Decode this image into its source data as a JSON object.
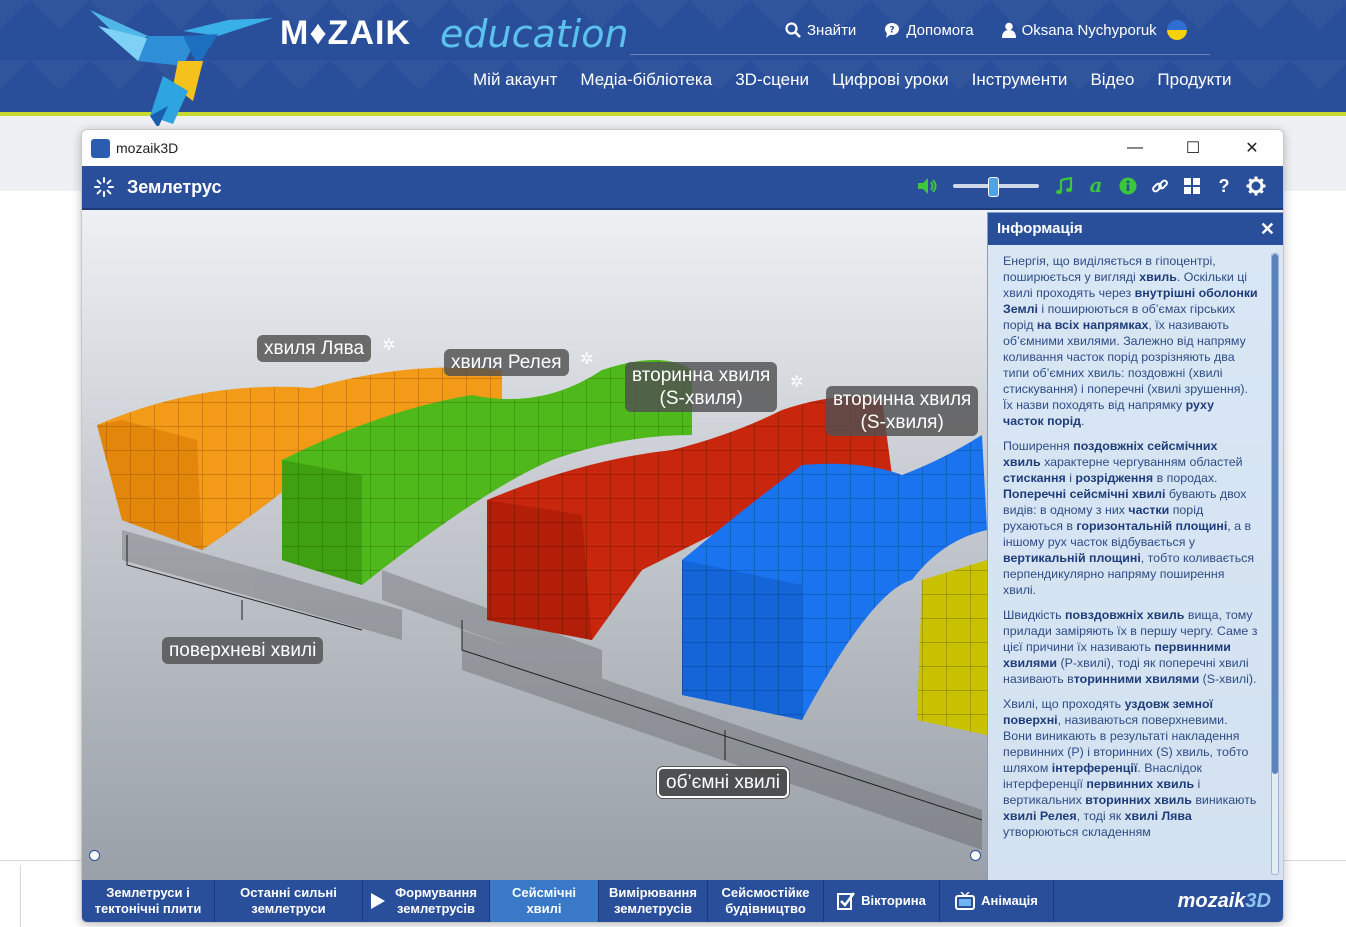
{
  "site": {
    "logo_text": "M♦ZAIK",
    "logo_sub": "education",
    "top_links": [
      {
        "icon": "search-icon",
        "label": "Знайти"
      },
      {
        "icon": "help-chat-icon",
        "label": "Допомога"
      },
      {
        "icon": "user-icon",
        "label": "Oksana Nychyporuk"
      }
    ],
    "nav": [
      "Мій акаунт",
      "Медіа-бібліотека",
      "3D-сцени",
      "Цифрові уроки",
      "Інструменти",
      "Відео",
      "Продукти"
    ]
  },
  "window": {
    "title": "mozaik3D",
    "controls": {
      "minimize": "—",
      "maximize": "☐",
      "close": "✕"
    }
  },
  "toolbar": {
    "scene_title": "Землетрус",
    "volume_level": 0.45,
    "icons": [
      "speaker-icon",
      "music-icon",
      "text-a-icon",
      "info-icon",
      "link-icon",
      "grid-icon",
      "help-icon",
      "gear-icon"
    ]
  },
  "scene": {
    "labels": {
      "love": "хвиля Лява",
      "rayleigh": "хвиля Релея",
      "s_wave_1": "вторинна хвиля\n(S-хвиля)",
      "s_wave_2": "вторинна хвиля\n(S-хвиля)",
      "surface": "поверхневі хвилі",
      "body": "об’ємні хвилі"
    },
    "colors": {
      "orange": "#f39a18",
      "green": "#4fb81a",
      "red": "#c9260e",
      "blue": "#1a74f0",
      "yellow": "#c8c200"
    }
  },
  "info": {
    "title": "Інформація",
    "close": "✕"
  },
  "tabs": [
    {
      "label": "Землетруси і тектонічні плити",
      "active": false
    },
    {
      "label": "Останні сильні землетруси",
      "active": false
    },
    {
      "label": "Формування землетрусів",
      "active": false
    },
    {
      "label": "Сейсмічні хвилі",
      "active": true
    },
    {
      "label": "Вимірювання землетрусів",
      "active": false
    },
    {
      "label": "Сейсмостійке будівництво",
      "active": false
    },
    {
      "label": "Вікторина",
      "active": false
    },
    {
      "label": "Анімація",
      "active": false
    }
  ],
  "brand": {
    "a": "mozaik",
    "b": "3D"
  }
}
